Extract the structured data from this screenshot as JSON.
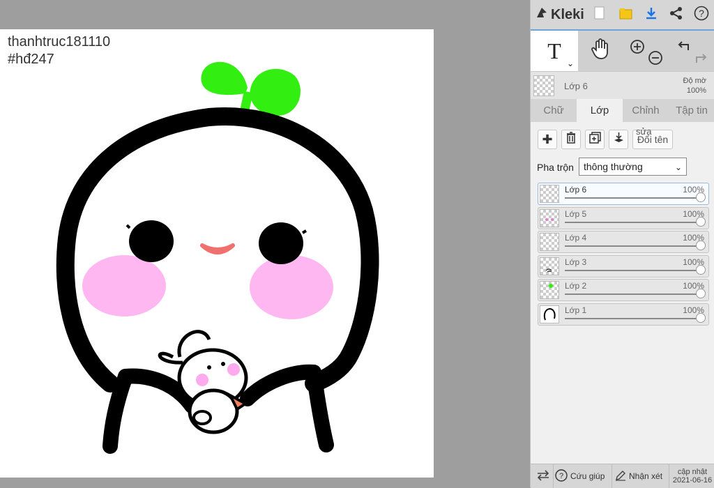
{
  "app": {
    "name": "Kleki"
  },
  "canvas": {
    "text_line1": "thanhtruc181110",
    "text_line2": "#hđ247"
  },
  "toolbar": {
    "text_tool_glyph": "T",
    "icons": [
      "kleki-logo-icon",
      "new-file-icon",
      "folder-open-icon",
      "download-icon",
      "share-icon",
      "help-icon",
      "text-tool-icon",
      "hand-tool-icon",
      "zoom-in-icon",
      "zoom-out-icon",
      "undo-icon",
      "redo-icon"
    ]
  },
  "current_layer": {
    "name": "Lớp 6",
    "opacity_label": "Độ mờ",
    "opacity_value": "100%"
  },
  "tabs": [
    {
      "label": "Chữ",
      "active": false
    },
    {
      "label": "Lớp",
      "active": true
    },
    {
      "label": "Chỉnh",
      "active": false
    },
    {
      "label": "Tập tin",
      "active": false
    }
  ],
  "layer_panel": {
    "rename_top": "sửa",
    "rename_label": "Đổi tên",
    "blend_label": "Pha trộn",
    "blend_value": "thông thường"
  },
  "layers": [
    {
      "name": "Lớp 6",
      "opacity": "100%",
      "active": true
    },
    {
      "name": "Lớp 5",
      "opacity": "100%",
      "active": false
    },
    {
      "name": "Lớp 4",
      "opacity": "100%",
      "active": false
    },
    {
      "name": "Lớp 3",
      "opacity": "100%",
      "active": false
    },
    {
      "name": "Lớp 2",
      "opacity": "100%",
      "active": false
    },
    {
      "name": "Lớp 1",
      "opacity": "100%",
      "active": false
    }
  ],
  "bottom": {
    "help_label": "Cứu giúp",
    "feedback_label": "Nhận xét",
    "update_label": "cập nhật",
    "update_date": "2021-06-16"
  },
  "colors": {
    "accent": "#6ea4d8",
    "sprout": "#33ee11",
    "blush": "#ffaaee",
    "mouth": "#f07070"
  }
}
